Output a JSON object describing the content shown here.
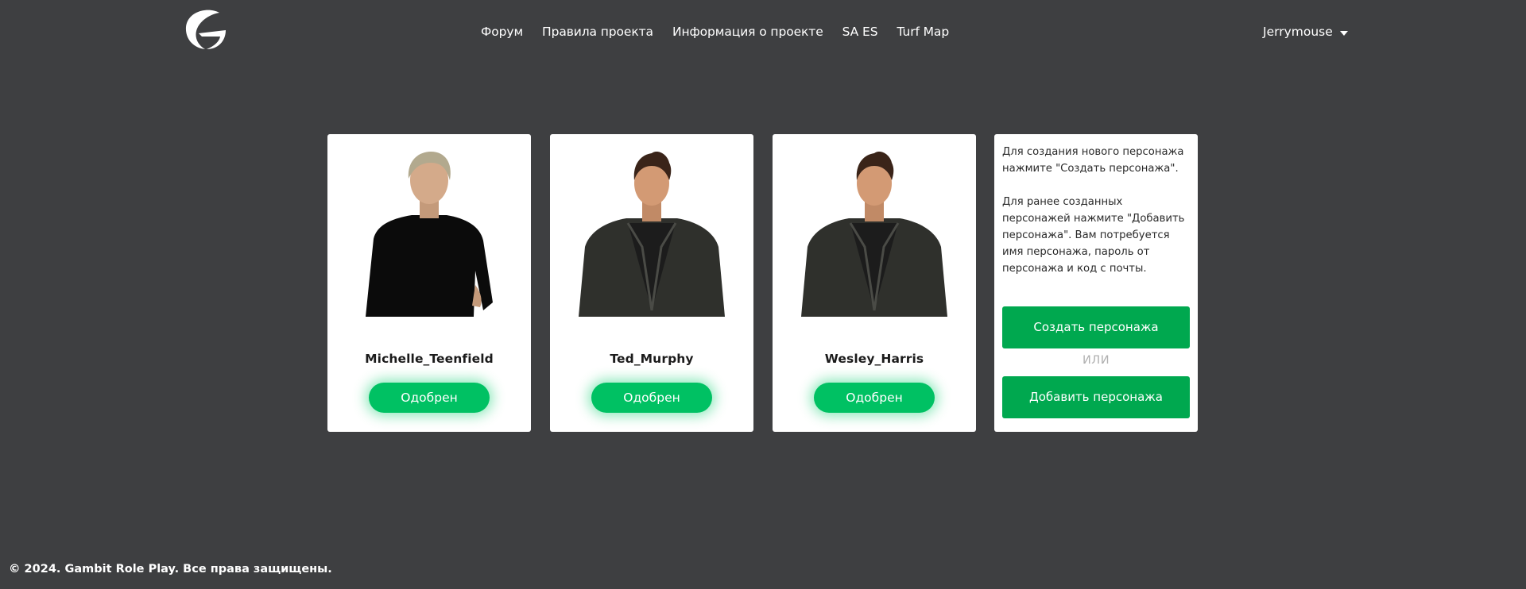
{
  "header": {
    "logo": "gambit-logo-icon",
    "nav": [
      {
        "label": "Форум"
      },
      {
        "label": "Правила проекта"
      },
      {
        "label": "Информация о проекте"
      },
      {
        "label": "SA ES"
      },
      {
        "label": "Turf Map"
      }
    ],
    "user": {
      "name": "Jerrymouse",
      "icon": "chevron-down-icon"
    }
  },
  "characters": [
    {
      "name": "Michelle_Teenfield",
      "status": "Одобрен",
      "avatar": "female-character-avatar"
    },
    {
      "name": "Ted_Murphy",
      "status": "Одобрен",
      "avatar": "male-character-avatar"
    },
    {
      "name": "Wesley_Harris",
      "status": "Одобрен",
      "avatar": "male-character-avatar"
    }
  ],
  "info": {
    "para1": "Для создания нового персонажа нажмите \"Создать персонажа\".",
    "para2": "Для ранее созданных персонажей нажмите \"Добавить персонажа\". Вам потребуется имя персонажа, пароль от персонажа и код с почты.",
    "create_label": "Создать персонажа",
    "or_label": "ИЛИ",
    "add_label": "Добавить персонажа"
  },
  "footer": {
    "text": "© 2024. Gambit Role Play. Все права защищены."
  },
  "colors": {
    "background": "#3e3f41",
    "accent": "#00a84f",
    "status": "#00c163"
  }
}
